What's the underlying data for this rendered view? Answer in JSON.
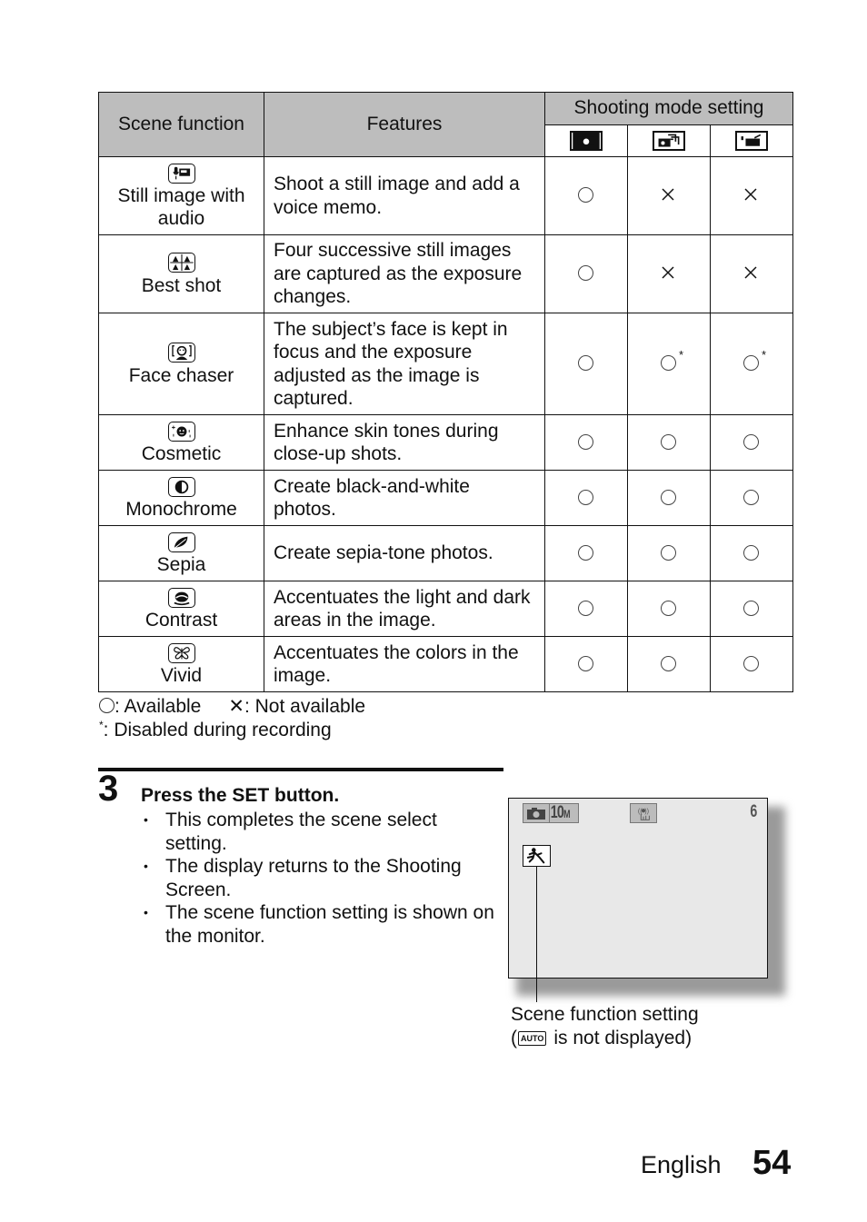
{
  "table": {
    "headers": {
      "scene_function": "Scene function",
      "features": "Features",
      "shooting_mode_setting": "Shooting mode setting",
      "modes": [
        {
          "icon": "still-camera-icon"
        },
        {
          "icon": "still-camera-burst-icon"
        },
        {
          "icon": "video-camera-icon"
        }
      ]
    },
    "rows": [
      {
        "icon": "still-image-audio-icon",
        "name": "Still image with audio",
        "feature": "Shoot a still image and add a voice memo.",
        "marks": [
          "available",
          "not_available",
          "not_available"
        ]
      },
      {
        "icon": "best-shot-icon",
        "name": "Best shot",
        "feature": "Four successive still images are captured as the exposure changes.",
        "marks": [
          "available",
          "not_available",
          "not_available"
        ]
      },
      {
        "icon": "face-chaser-icon",
        "name": "Face chaser",
        "feature": "The subject’s face is kept in focus and the exposure adjusted as the image is captured.",
        "marks": [
          "available",
          "available_disabled_recording",
          "available_disabled_recording"
        ]
      },
      {
        "icon": "cosmetic-icon",
        "name": "Cosmetic",
        "feature": "Enhance skin tones during close-up shots.",
        "marks": [
          "available",
          "available",
          "available"
        ]
      },
      {
        "icon": "monochrome-icon",
        "name": "Monochrome",
        "feature": "Create black-and-white photos.",
        "marks": [
          "available",
          "available",
          "available"
        ]
      },
      {
        "icon": "sepia-icon",
        "name": "Sepia",
        "feature": "Create sepia-tone photos.",
        "marks": [
          "available",
          "available",
          "available"
        ]
      },
      {
        "icon": "contrast-icon",
        "name": "Contrast",
        "feature": "Accentuates the light and dark areas in the image.",
        "marks": [
          "available",
          "available",
          "available"
        ]
      },
      {
        "icon": "vivid-icon",
        "name": "Vivid",
        "feature": "Accentuates the colors in the image.",
        "marks": [
          "available",
          "available",
          "available"
        ]
      }
    ],
    "header_bg": "#bdbdbd",
    "asterisk": "*"
  },
  "legend": {
    "available": ": Available",
    "not_available": ": Not available",
    "asterisk_symbol": "*",
    "disabled": ":  Disabled during recording"
  },
  "step": {
    "number": "3",
    "title": "Press the SET button.",
    "bullets": [
      "This completes the scene select setting.",
      "The display returns to the Shooting Screen.",
      "The scene function setting is shown on the monitor."
    ]
  },
  "monitor": {
    "image_size": "10",
    "image_size_unit": "M",
    "shots_remaining": "6",
    "scene_icon": "sports-runner-icon",
    "caption_line1": "Scene function setting",
    "caption_open": "(",
    "auto_badge": "AUTO",
    "caption_line2_rest": "is not displayed)",
    "screen_bg": "#e8e8e8"
  },
  "footer": {
    "language": "English",
    "page_number": "54"
  }
}
